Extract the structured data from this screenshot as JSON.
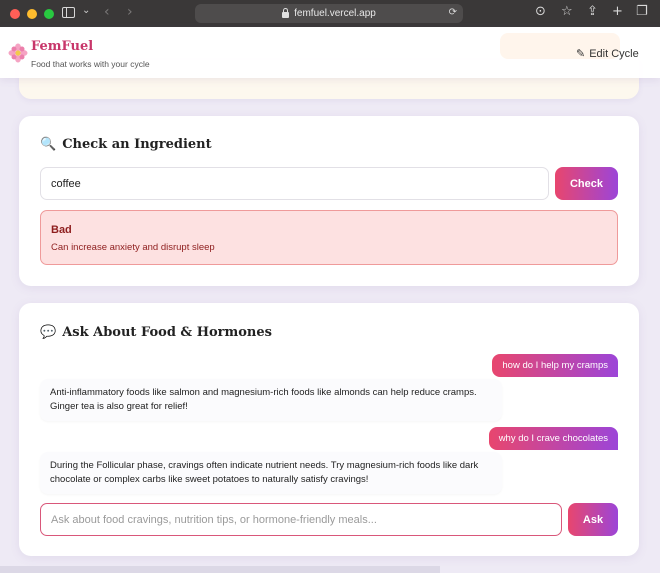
{
  "browser": {
    "url": "femfuel.vercel.app"
  },
  "header": {
    "brand": "FemFuel",
    "tagline": "Food that works with your cycle",
    "edit_cycle_label": "Edit Cycle"
  },
  "ingredient_card": {
    "title": "Check an Ingredient",
    "input_value": "coffee",
    "check_label": "Check",
    "result": {
      "verdict": "Bad",
      "description": "Can increase anxiety and disrupt sleep"
    }
  },
  "chat_card": {
    "title": "Ask About Food & Hormones",
    "messages": [
      {
        "role": "user",
        "text": "how do I help my cramps"
      },
      {
        "role": "assistant",
        "text": "Anti-inflammatory foods like salmon and magnesium-rich foods like almonds can help reduce cramps. Ginger tea is also great for relief!"
      },
      {
        "role": "user",
        "text": "why do I crave chocolates"
      },
      {
        "role": "assistant",
        "text": "During the Follicular phase, cravings often indicate nutrient needs. Try magnesium-rich foods like dark chocolate or complex carbs like sweet potatoes to naturally satisfy cravings!"
      }
    ],
    "input_placeholder": "Ask about food cravings, nutrition tips, or hormone-friendly meals...",
    "ask_label": "Ask"
  },
  "colors": {
    "brand": "#c8366a",
    "gradient_start": "#e8466e",
    "gradient_end": "#9c45d8",
    "bad_bg": "#fde1e1",
    "bad_text": "#8e1e1e"
  }
}
